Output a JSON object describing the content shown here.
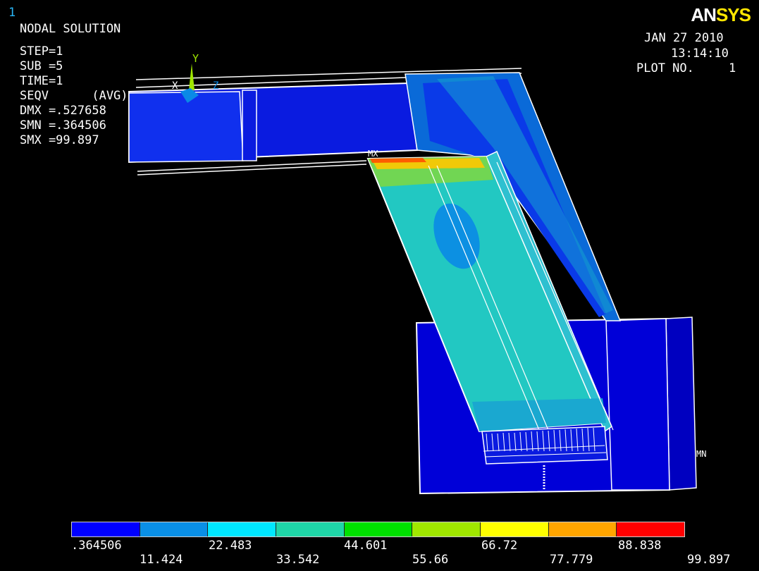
{
  "window": {
    "number": "1"
  },
  "logo": {
    "part1": "AN",
    "part2": "SYS"
  },
  "info": {
    "lines": [
      "NODAL SOLUTION",
      "STEP=1",
      "SUB =5",
      "TIME=1",
      "SEQV      (AVG)",
      "DMX =.527658",
      "SMN =.364506",
      "SMX =99.897"
    ]
  },
  "plot_meta": {
    "date": "JAN 27 2010",
    "time": "13:14:10",
    "plot_label": "PLOT NO.",
    "plot_no": "1"
  },
  "triad": {
    "y": "Y",
    "x": "X",
    "z": "Z"
  },
  "markers": {
    "mx": "MX",
    "mn": "MN"
  },
  "legend": {
    "colors": [
      "#0000ff",
      "#0a8fe6",
      "#00e8ff",
      "#1fd6a8",
      "#00e000",
      "#a0e800",
      "#ffff00",
      "#ffa500",
      "#ff0000"
    ],
    "labels_top": [
      ".364506",
      "22.483",
      "44.601",
      "66.72",
      "88.838"
    ],
    "labels_bottom": [
      "11.424",
      "33.542",
      "55.66",
      "77.779",
      "99.897"
    ]
  }
}
